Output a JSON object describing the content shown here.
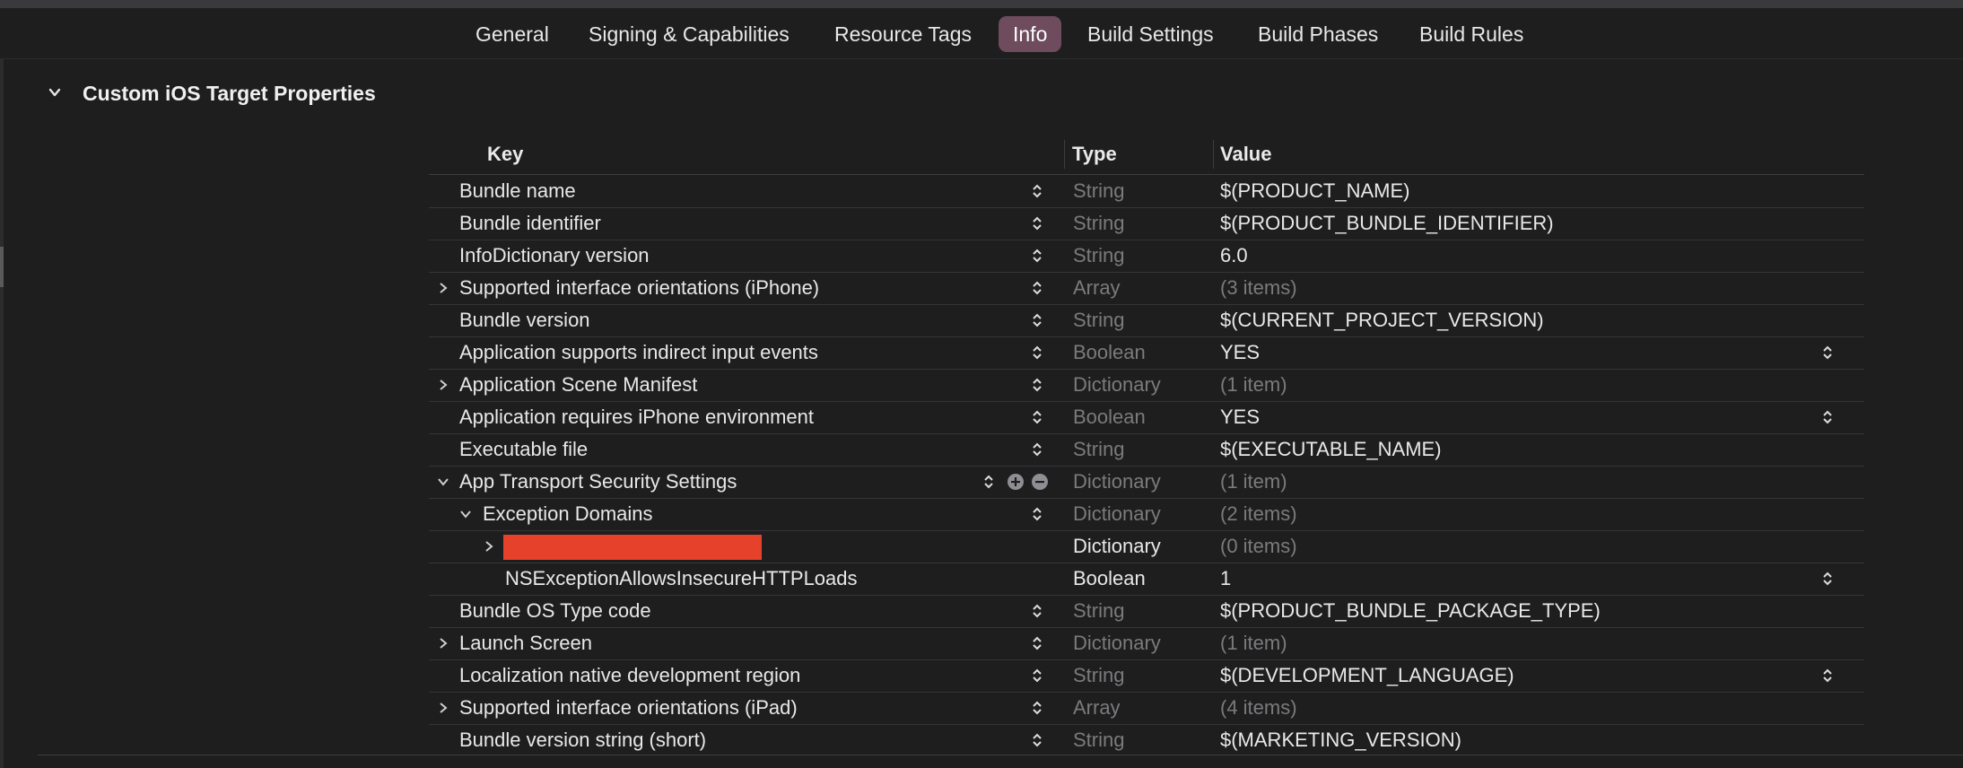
{
  "tabs": [
    "General",
    "Signing & Capabilities",
    "Resource Tags",
    "Info",
    "Build Settings",
    "Build Phases",
    "Build Rules"
  ],
  "active_tab": "Info",
  "section": {
    "title": "Custom iOS Target Properties"
  },
  "columns": {
    "key": "Key",
    "type": "Type",
    "value": "Value"
  },
  "rows": [
    {
      "key": "Bundle name",
      "type": "String",
      "value": "$(PRODUCT_NAME)"
    },
    {
      "key": "Bundle identifier",
      "type": "String",
      "value": "$(PRODUCT_BUNDLE_IDENTIFIER)"
    },
    {
      "key": "InfoDictionary version",
      "type": "String",
      "value": "6.0"
    },
    {
      "key": "Supported interface orientations (iPhone)",
      "type": "Array",
      "value": "(3 items)"
    },
    {
      "key": "Bundle version",
      "type": "String",
      "value": "$(CURRENT_PROJECT_VERSION)"
    },
    {
      "key": "Application supports indirect input events",
      "type": "Boolean",
      "value": "YES"
    },
    {
      "key": "Application Scene Manifest",
      "type": "Dictionary",
      "value": "(1 item)"
    },
    {
      "key": "Application requires iPhone environment",
      "type": "Boolean",
      "value": "YES"
    },
    {
      "key": "Executable file",
      "type": "String",
      "value": "$(EXECUTABLE_NAME)"
    },
    {
      "key": "App Transport Security Settings",
      "type": "Dictionary",
      "value": "(1 item)"
    },
    {
      "key": "Exception Domains",
      "type": "Dictionary",
      "value": "(2 items)"
    },
    {
      "key": "",
      "type": "Dictionary",
      "value": "(0 items)"
    },
    {
      "key": "NSExceptionAllowsInsecureHTTPLoads",
      "type": "Boolean",
      "value": "1"
    },
    {
      "key": "Bundle OS Type code",
      "type": "String",
      "value": "$(PRODUCT_BUNDLE_PACKAGE_TYPE)"
    },
    {
      "key": "Launch Screen",
      "type": "Dictionary",
      "value": "(1 item)"
    },
    {
      "key": "Localization native development region",
      "type": "String",
      "value": "$(DEVELOPMENT_LANGUAGE)"
    },
    {
      "key": "Supported interface orientations (iPad)",
      "type": "Array",
      "value": "(4 items)"
    },
    {
      "key": "Bundle version string (short)",
      "type": "String",
      "value": "$(MARKETING_VERSION)"
    }
  ],
  "colors": {
    "accent_tab": "#6e4b5d",
    "redaction": "#e6412a",
    "background": "#1e1e1f"
  },
  "icons": [
    "chevron-down-icon",
    "chevron-right-icon",
    "stepper-icon",
    "plus-circle-icon",
    "minus-circle-icon"
  ]
}
